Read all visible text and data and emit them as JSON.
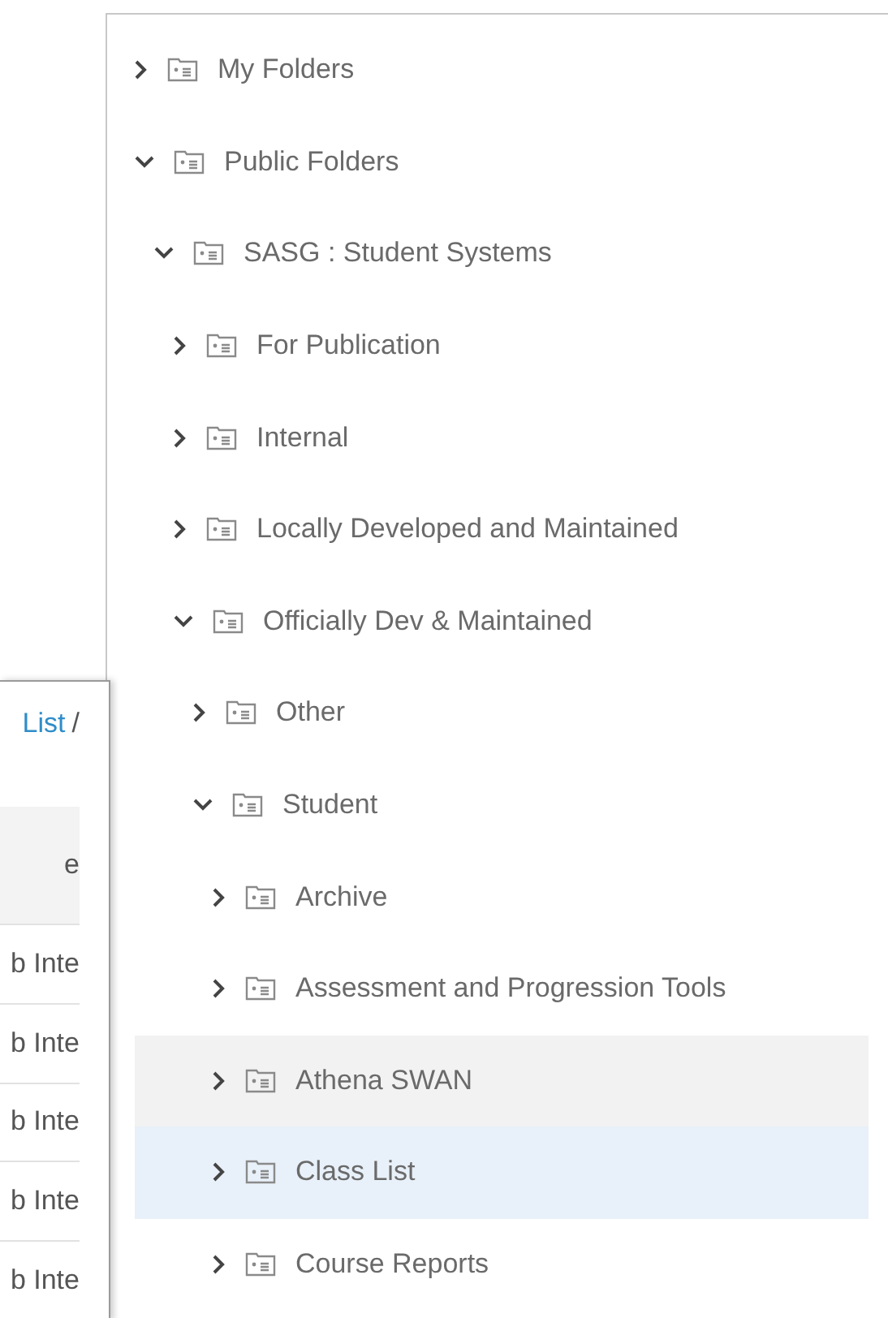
{
  "folder_tree": [
    {
      "label": "My Folders",
      "expanded": false,
      "selected": false,
      "hovered": false
    },
    {
      "label": "Public Folders",
      "expanded": true,
      "selected": false,
      "hovered": false,
      "children": [
        {
          "label": "SASG : Student Systems",
          "expanded": true,
          "selected": false,
          "hovered": false,
          "children": [
            {
              "label": "For Publication",
              "expanded": false,
              "selected": false,
              "hovered": false
            },
            {
              "label": "Internal",
              "expanded": false,
              "selected": false,
              "hovered": false
            },
            {
              "label": "Locally Developed and Maintained",
              "expanded": false,
              "selected": false,
              "hovered": false
            },
            {
              "label": "Officially Dev & Maintained",
              "expanded": true,
              "selected": false,
              "hovered": false,
              "children": [
                {
                  "label": "Other",
                  "expanded": false,
                  "selected": false,
                  "hovered": false
                },
                {
                  "label": "Student",
                  "expanded": true,
                  "selected": false,
                  "hovered": false,
                  "children": [
                    {
                      "label": "Archive",
                      "expanded": false,
                      "selected": false,
                      "hovered": false
                    },
                    {
                      "label": "Assessment and Progression Tools",
                      "expanded": false,
                      "selected": false,
                      "hovered": false
                    },
                    {
                      "label": "Athena SWAN",
                      "expanded": false,
                      "selected": false,
                      "hovered": true
                    },
                    {
                      "label": "Class List",
                      "expanded": false,
                      "selected": true,
                      "hovered": false
                    },
                    {
                      "label": "Course Reports",
                      "expanded": false,
                      "selected": false,
                      "hovered": false
                    }
                  ]
                }
              ]
            }
          ]
        }
      ]
    }
  ],
  "background_panel": {
    "breadcrumb": {
      "link": "List",
      "separator": "/"
    },
    "table": {
      "column_1": "e",
      "rows": [
        "b Inte",
        "b Inte",
        "b Inte",
        "b Inte",
        "b Inte"
      ]
    }
  }
}
